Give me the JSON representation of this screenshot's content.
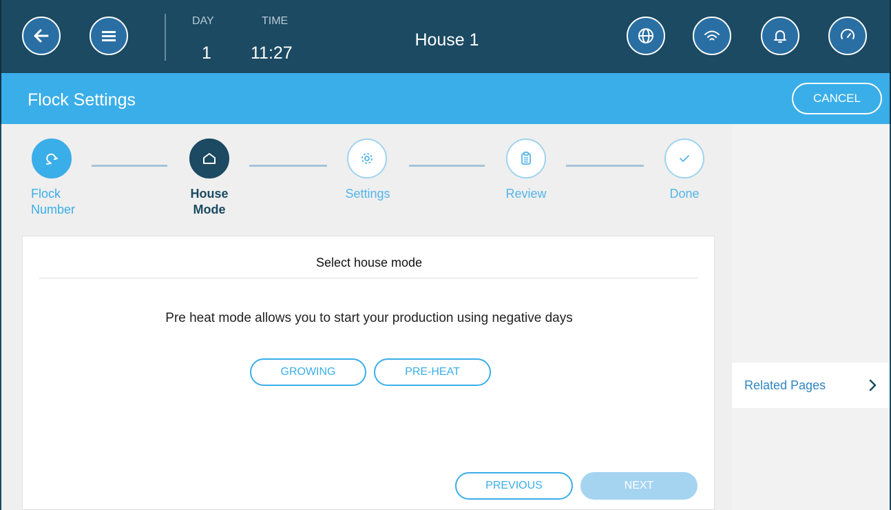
{
  "header": {
    "day_label": "DAY",
    "day_value": "1",
    "time_label": "TIME",
    "time_value": "11:27",
    "house_name": "House 1"
  },
  "toolbar": {
    "title": "Flock Settings",
    "cancel_label": "CANCEL"
  },
  "wizard": {
    "steps": [
      {
        "line1": "Flock",
        "line2": "Number",
        "state": "done",
        "icon": "bird-icon"
      },
      {
        "line1": "House",
        "line2": "Mode",
        "state": "current",
        "icon": "house-icon"
      },
      {
        "line1": "Settings",
        "line2": "",
        "state": "future",
        "icon": "gear-icon"
      },
      {
        "line1": "Review",
        "line2": "",
        "state": "future",
        "icon": "clipboard-icon"
      },
      {
        "line1": "Done",
        "line2": "",
        "state": "future",
        "icon": "check-icon"
      }
    ]
  },
  "card": {
    "title": "Select house mode",
    "description": "Pre heat mode allows you to start your production using negative days",
    "options": [
      "GROWING",
      "PRE-HEAT"
    ],
    "previous_label": "PREVIOUS",
    "next_label": "NEXT"
  },
  "sidebar": {
    "related_label": "Related Pages"
  },
  "colors": {
    "header_bg": "#1b4a62",
    "accent": "#3aaee9",
    "icon_button": "#2a6fa3",
    "disabled": "#a5d4f1"
  }
}
